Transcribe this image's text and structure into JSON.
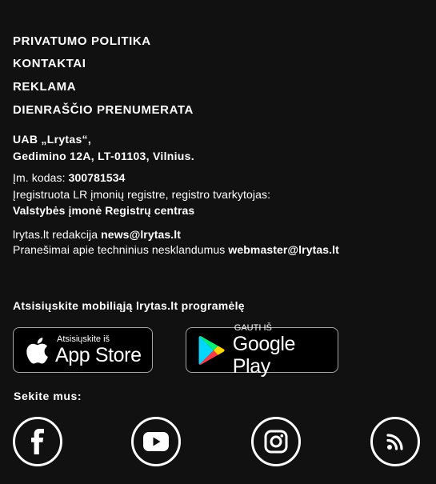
{
  "nav": {
    "privacy": "PRIVATUMO POLITIKA",
    "contacts": "KONTAKTAI",
    "advertising": "REKLAMA",
    "subscription": "DIENRAŠČIO PRENUMERATA"
  },
  "company": {
    "name": "UAB „Lrytas“,",
    "address": "Gedimino 12A, LT-01103, Vilnius.",
    "code_label": "Įm. kodas:",
    "code_value": "300781534",
    "registry_text": "Įregistruota LR įmonių registre, registro tvarkytojas:",
    "registry_holder": "Valstybės įmonė Registrų centras"
  },
  "contacts_block": {
    "editorial_label": "lrytas.lt redakcija",
    "editorial_email": "news@lrytas.lt",
    "tech_label": "Pranešimai apie techninius nesklandumus",
    "tech_email": "webmaster@lrytas.lt"
  },
  "app": {
    "title": "Atsisiųskite mobiliąją lrytas.lt programėlę",
    "apple_small": "Atsisiųskite iš",
    "apple_big": "App Store",
    "google_small": "GAUTI IŠ",
    "google_big": "Google Play"
  },
  "social": {
    "title": "Sekite mus:",
    "icons": [
      "facebook-icon",
      "youtube-icon",
      "instagram-icon",
      "rss-icon"
    ]
  },
  "colors": {
    "background": "#111111",
    "text": "#ffffff",
    "badge_border": "#a6a6a6",
    "google_blue": "#00d7fe",
    "google_green": "#00f076",
    "google_yellow": "#ffd500",
    "google_red": "#ff3a44"
  }
}
